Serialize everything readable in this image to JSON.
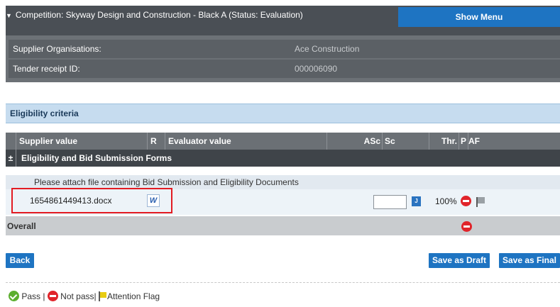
{
  "header": {
    "title": "Competition: Skyway Design and Construction - Black A (Status: Evaluation)",
    "show_menu_label": "Show Menu"
  },
  "info": {
    "rows": [
      {
        "label": "Supplier Organisations:",
        "value": "Ace Construction"
      },
      {
        "label": "Tender receipt ID:",
        "value": "000006090"
      }
    ]
  },
  "section": {
    "title": "Eligibility criteria"
  },
  "table": {
    "columns": {
      "supplier_value": "Supplier value",
      "r": "R",
      "evaluator_value": "Evaluator value",
      "asc": "ASc",
      "sc": "Sc",
      "thr": "Thr.",
      "p": "P",
      "af": "AF"
    },
    "group": {
      "toggle": "±",
      "label": "Eligibility and Bid Submission Forms"
    },
    "question": "Please attach file containing Bid Submission and Eligibility Documents",
    "answer": {
      "file_name": "1654861449413.docx",
      "word_icon": "W",
      "score_button": "J",
      "threshold": "100%"
    },
    "overall_label": "Overall"
  },
  "buttons": {
    "back": "Back",
    "save_draft": "Save as Draft",
    "save_final": "Save as Final"
  },
  "legend": {
    "pass": "Pass |",
    "not_pass": "Not pass|",
    "attention": "Attention Flag"
  },
  "colors": {
    "accent": "#1e74c2",
    "header_bg": "#4a4f55",
    "highlight": "#e21b22",
    "pass": "#5cae2f",
    "not_pass": "#e0242a",
    "flag": "#e8cc12"
  }
}
